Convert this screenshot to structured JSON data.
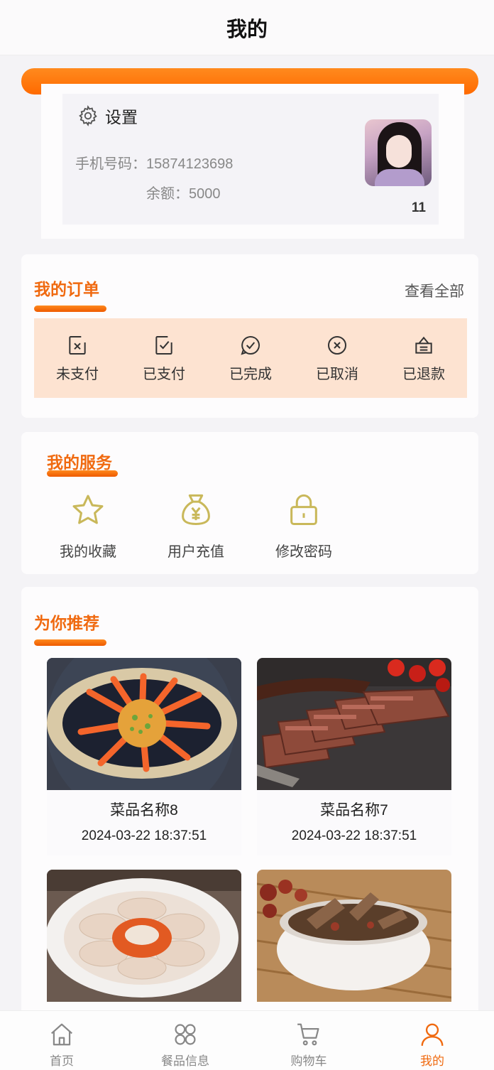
{
  "header": {
    "title": "我的"
  },
  "profile": {
    "settings_label": "设置",
    "phone_label": "手机号码：",
    "phone": "15874123698",
    "balance_label": "余额：",
    "balance": "5000",
    "count": "11"
  },
  "orders": {
    "title": "我的订单",
    "view_all": "查看全部",
    "items": [
      {
        "label": "未支付",
        "icon": "unpaid-icon"
      },
      {
        "label": "已支付",
        "icon": "paid-icon"
      },
      {
        "label": "已完成",
        "icon": "completed-icon"
      },
      {
        "label": "已取消",
        "icon": "cancelled-icon"
      },
      {
        "label": "已退款",
        "icon": "refunded-icon"
      }
    ]
  },
  "services": {
    "title": "我的服务",
    "items": [
      {
        "label": "我的收藏",
        "icon": "star-icon"
      },
      {
        "label": "用户充值",
        "icon": "money-bag-icon"
      },
      {
        "label": "修改密码",
        "icon": "lock-icon"
      }
    ]
  },
  "recommend": {
    "title": "为你推荐",
    "items": [
      {
        "name": "菜品名称8",
        "time": "2024-03-22 18:37:51"
      },
      {
        "name": "菜品名称7",
        "time": "2024-03-22 18:37:51"
      },
      {
        "name": "",
        "time": ""
      },
      {
        "name": "",
        "time": ""
      }
    ]
  },
  "tabbar": {
    "items": [
      {
        "label": "首页",
        "icon": "home-icon"
      },
      {
        "label": "餐品信息",
        "icon": "grid-icon"
      },
      {
        "label": "购物车",
        "icon": "cart-icon"
      },
      {
        "label": "我的",
        "icon": "user-icon",
        "active": true
      }
    ]
  },
  "colors": {
    "accent": "#f06a10",
    "order_bg": "#fde3d1",
    "service_icon": "#c9b85a"
  }
}
